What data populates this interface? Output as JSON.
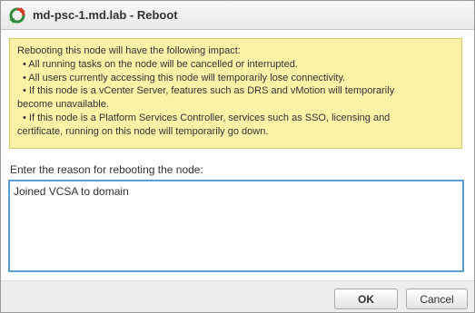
{
  "window": {
    "title": "md-psc-1.md.lab - Reboot",
    "icon": "reboot-icon"
  },
  "warning": {
    "intro": "Rebooting this node will have the following impact:",
    "items": [
      "• All running tasks on the node will be cancelled or interrupted.",
      "• All users currently accessing this node will temporarily lose connectivity.",
      "• If this node is a vCenter Server, features such as DRS and vMotion will temporarily",
      "become unavailable.",
      "• If this node is a Platform Services Controller, services such as SSO, licensing and",
      "certificate, running on this node will temporarily go down."
    ]
  },
  "reason": {
    "label": "Enter the reason for rebooting the node:",
    "value": "Joined VCSA to domain"
  },
  "buttons": {
    "ok": "OK",
    "cancel": "Cancel"
  },
  "colors": {
    "warning_bg": "#fbf2a8",
    "input_focus_border": "#5aa0d4"
  }
}
